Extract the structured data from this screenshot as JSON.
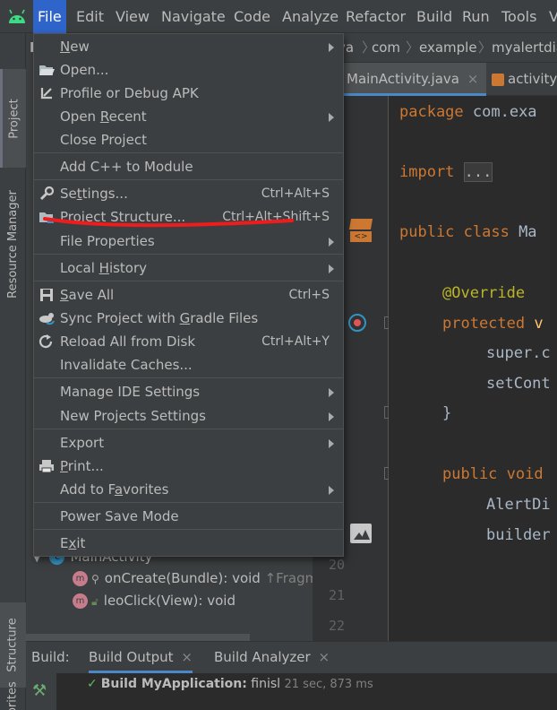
{
  "menubar": {
    "items": [
      "File",
      "Edit",
      "View",
      "Navigate",
      "Code",
      "Analyze",
      "Refactor",
      "Build",
      "Run",
      "Tools",
      "V"
    ],
    "active": "File"
  },
  "project_panel": {
    "header": "My",
    "tree": {
      "class_name": "MainActivity",
      "methods": [
        {
          "label": "onCreate(Bundle): void",
          "hint": "↑Fragm"
        },
        {
          "label": "leoClick(View): void",
          "hint": ""
        }
      ]
    }
  },
  "side_tabs": {
    "project": "Project",
    "resource_manager": "Resource Manager",
    "structure": "Structure",
    "favorites": "vorites"
  },
  "navbar": {
    "crumbs": [
      "va",
      "com",
      "example",
      "myalertdia"
    ]
  },
  "editor_tabs": [
    {
      "label": "MainActivity.java",
      "close": "×"
    },
    {
      "label": "activity",
      "close": ""
    }
  ],
  "editor": {
    "line_numbers": [
      "20",
      "21",
      "22"
    ],
    "lines": [
      {
        "kw": "package ",
        "rest": "com.exa"
      },
      {
        "kw": "import ",
        "rest": "..."
      },
      {
        "kw": "public class ",
        "rest": "Ma"
      },
      {
        "kw": "@Override",
        "rest": ""
      },
      {
        "kw": "protected ",
        "rest": "v"
      },
      {
        "kw": "",
        "rest": "super.c"
      },
      {
        "kw": "",
        "rest": "setCont"
      },
      {
        "kw": "",
        "rest": "}"
      },
      {
        "kw": "public ",
        "rest": "void"
      },
      {
        "kw": "",
        "rest": "AlertDi"
      },
      {
        "kw": "",
        "rest": "builder"
      }
    ]
  },
  "file_menu": {
    "items": [
      {
        "label": "New",
        "mnemonic": "N",
        "shortcut": "",
        "submenu": true,
        "icon": ""
      },
      {
        "label": "Open...",
        "mnemonic": "",
        "shortcut": "",
        "submenu": false,
        "icon": "folder-open-icon"
      },
      {
        "label": "Profile or Debug APK",
        "mnemonic": "",
        "shortcut": "",
        "submenu": false,
        "icon": "profile-apk-icon"
      },
      {
        "label": "Open Recent",
        "mnemonic": "R",
        "shortcut": "",
        "submenu": true,
        "icon": ""
      },
      {
        "label": "Close Project",
        "mnemonic": "",
        "shortcut": "",
        "submenu": false,
        "icon": ""
      },
      {
        "label": "Add C++ to Module",
        "mnemonic": "",
        "shortcut": "",
        "submenu": false,
        "icon": ""
      },
      {
        "label": "Settings...",
        "mnemonic": "t",
        "shortcut": "Ctrl+Alt+S",
        "submenu": false,
        "icon": "wrench-icon"
      },
      {
        "label": "Project Structure...",
        "mnemonic": "",
        "shortcut": "Ctrl+Alt+Shift+S",
        "submenu": false,
        "icon": "project-structure-icon"
      },
      {
        "label": "File Properties",
        "mnemonic": "",
        "shortcut": "",
        "submenu": true,
        "icon": ""
      },
      {
        "label": "Local History",
        "mnemonic": "H",
        "shortcut": "",
        "submenu": true,
        "icon": ""
      },
      {
        "label": "Save All",
        "mnemonic": "S",
        "shortcut": "Ctrl+S",
        "submenu": false,
        "icon": "save-icon"
      },
      {
        "label": "Sync Project with Gradle Files",
        "mnemonic": "G",
        "shortcut": "",
        "submenu": false,
        "icon": "gradle-sync-icon"
      },
      {
        "label": "Reload All from Disk",
        "mnemonic": "",
        "shortcut": "Ctrl+Alt+Y",
        "submenu": false,
        "icon": "reload-icon"
      },
      {
        "label": "Invalidate Caches...",
        "mnemonic": "",
        "shortcut": "",
        "submenu": false,
        "icon": ""
      },
      {
        "label": "Manage IDE Settings",
        "mnemonic": "",
        "shortcut": "",
        "submenu": true,
        "icon": ""
      },
      {
        "label": "New Projects Settings",
        "mnemonic": "",
        "shortcut": "",
        "submenu": true,
        "icon": ""
      },
      {
        "label": "Export",
        "mnemonic": "",
        "shortcut": "",
        "submenu": true,
        "icon": ""
      },
      {
        "label": "Print...",
        "mnemonic": "P",
        "shortcut": "",
        "submenu": false,
        "icon": "print-icon"
      },
      {
        "label": "Add to Favorites",
        "mnemonic": "a",
        "shortcut": "",
        "submenu": true,
        "icon": ""
      },
      {
        "label": "Power Save Mode",
        "mnemonic": "",
        "shortcut": "",
        "submenu": false,
        "icon": ""
      },
      {
        "label": "Exit",
        "mnemonic": "x",
        "shortcut": "",
        "submenu": false,
        "icon": ""
      }
    ]
  },
  "build_panel": {
    "label": "Build:",
    "tabs": [
      {
        "label": "Build Output",
        "close": "×"
      },
      {
        "label": "Build Analyzer",
        "close": "×"
      }
    ],
    "status_check": "✓",
    "status_title": "Build MyApplication:",
    "status_text": " finisl",
    "status_time": "21 sec, 873 ms"
  },
  "colors": {
    "accent": "#2f65ca",
    "menu_bg": "#3c3f41",
    "editor_bg": "#2b2b2b",
    "annotation": "#ff0000"
  }
}
